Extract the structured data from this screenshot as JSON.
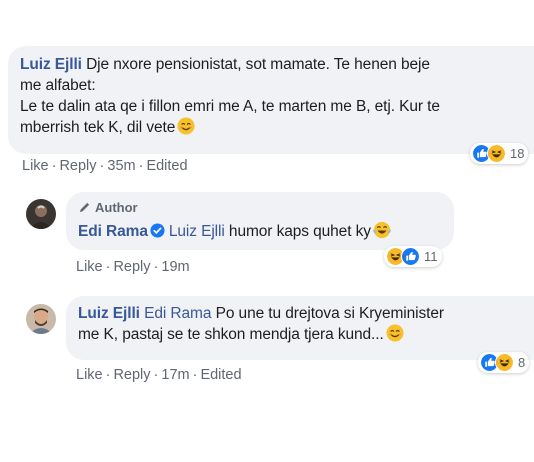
{
  "comments": [
    {
      "author": "Luiz Ejlli",
      "text_lines": [
        "Dje nxore pensionistat, sot mamate. Te henen beje",
        "me alfabet:",
        "Le te dalin ata qe i fillon emri me A, te marten me B, etj. Kur te",
        "mberrish tek K, dil vete"
      ],
      "emoji": "wink-smile-emoji",
      "actions": {
        "like": "Like",
        "reply": "Reply",
        "time": "35m",
        "edited": "Edited"
      },
      "reactions": {
        "count": "18",
        "icons": [
          "like-reaction-icon",
          "haha-reaction-icon"
        ]
      }
    },
    {
      "badge": "Author",
      "author": "Edi Rama",
      "verified": true,
      "mention": "Luiz Ejlli",
      "text": "humor kaps quhet ky",
      "emoji": "tears-of-joy-emoji",
      "actions": {
        "like": "Like",
        "reply": "Reply",
        "time": "19m"
      },
      "reactions": {
        "count": "11",
        "icons": [
          "haha-reaction-icon",
          "like-reaction-icon"
        ]
      }
    },
    {
      "author": "Luiz Ejlli",
      "mention": "Edi Rama",
      "text_lines": [
        "Po une tu drejtova si Kryeminister",
        "me K, pastaj se te shkon mendja tjera kund..."
      ],
      "emoji": "wink-smile-emoji",
      "actions": {
        "like": "Like",
        "reply": "Reply",
        "time": "17m",
        "edited": "Edited"
      },
      "reactions": {
        "count": "8",
        "icons": [
          "like-reaction-icon",
          "haha-reaction-icon"
        ]
      }
    }
  ],
  "colors": {
    "name": "#385898",
    "bubble": "#f0f2f5",
    "meta": "#606770",
    "like": "#1877f2",
    "haha": "#f7b928"
  }
}
